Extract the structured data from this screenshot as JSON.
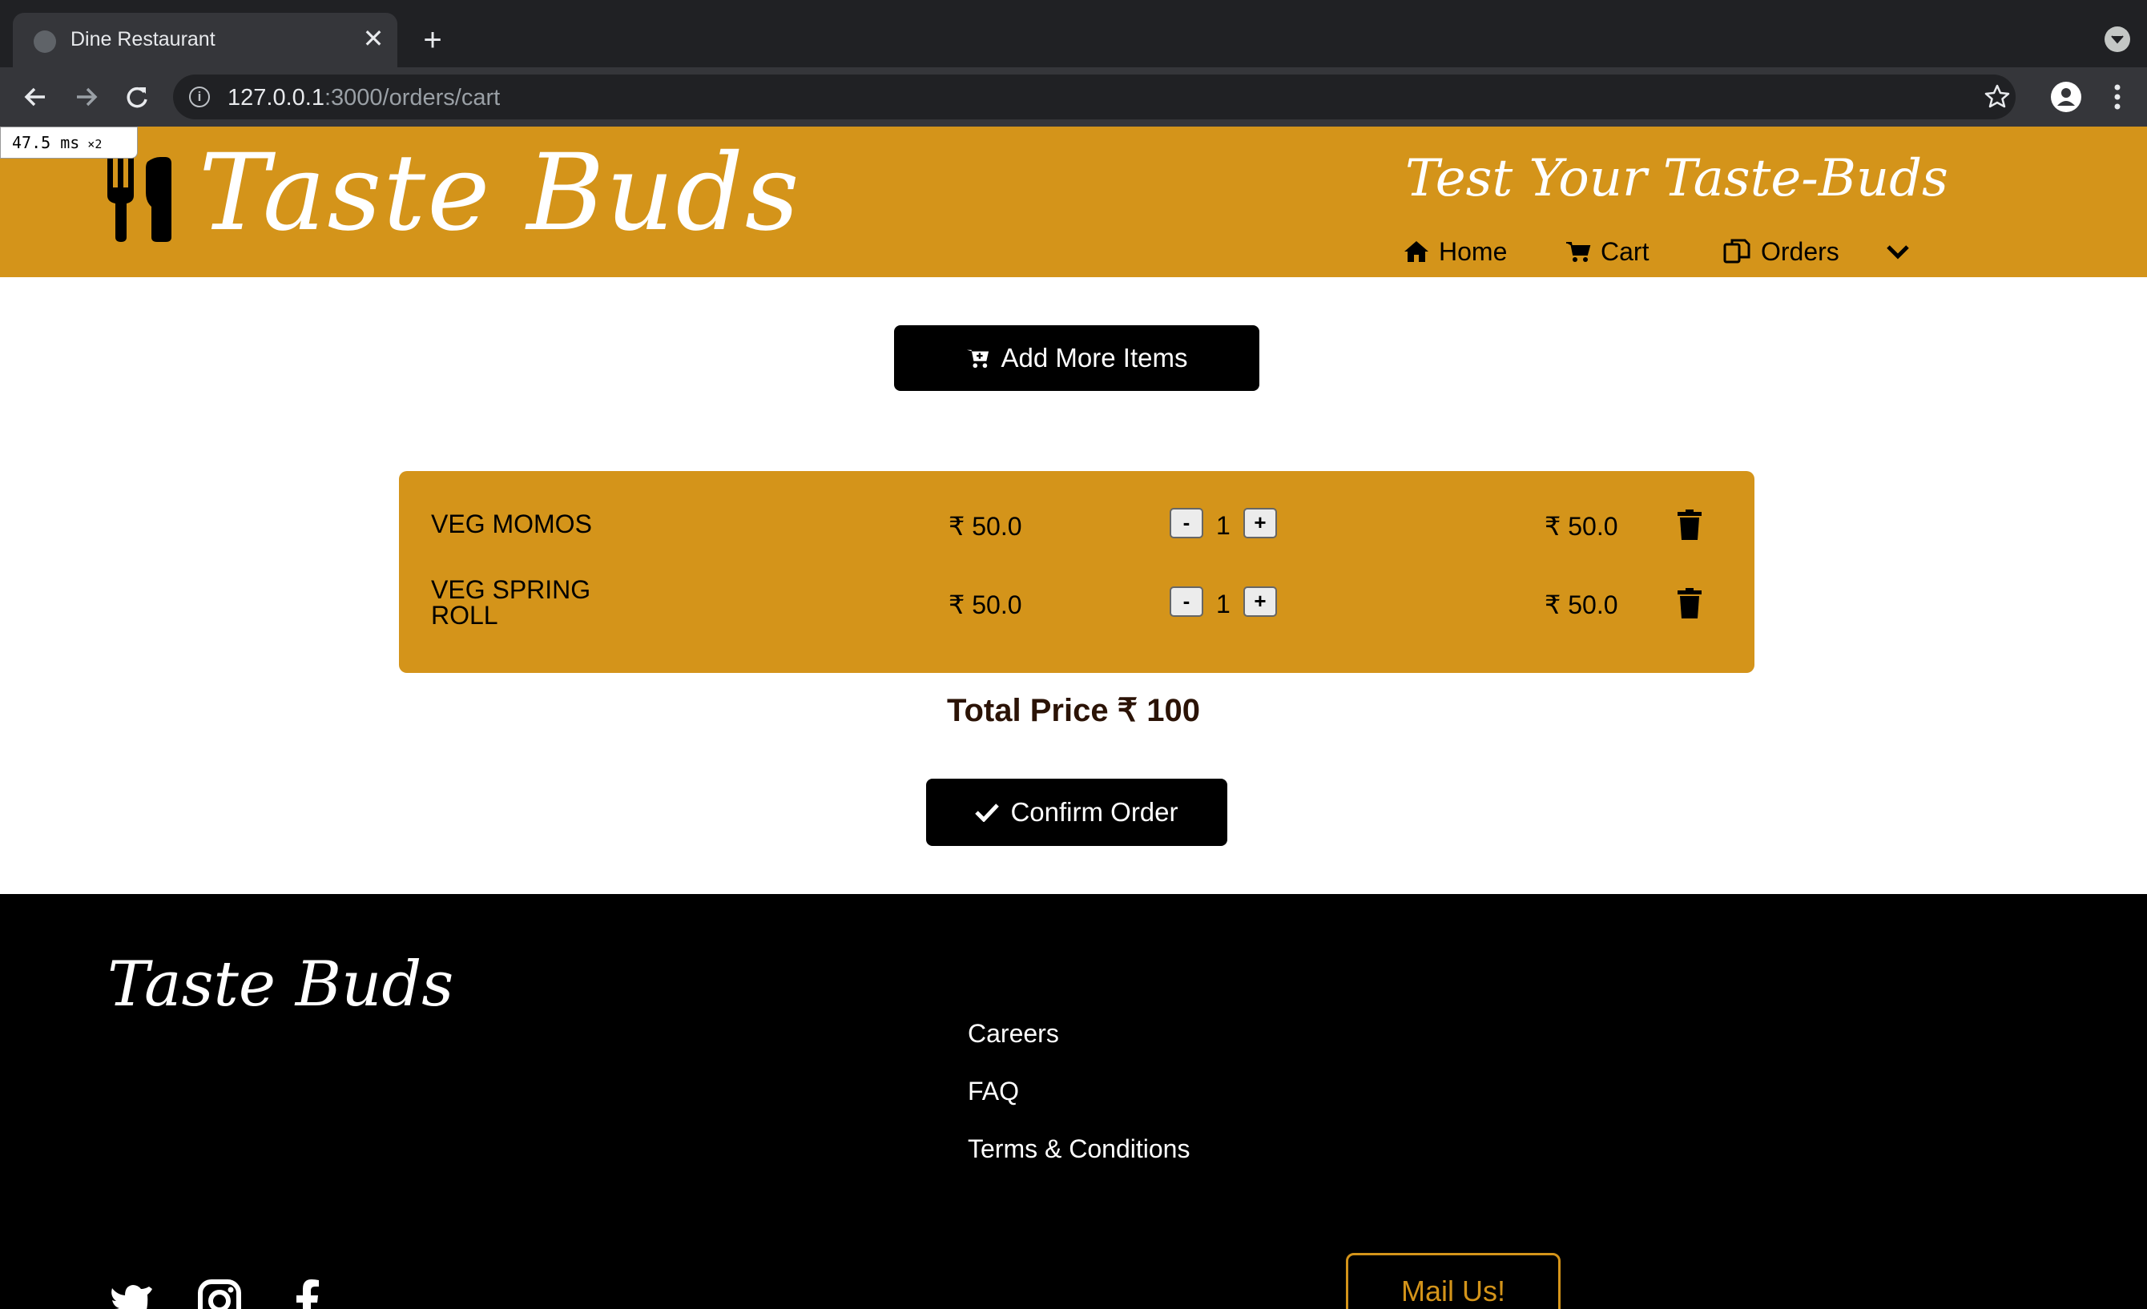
{
  "browser": {
    "tab_title": "Dine Restaurant",
    "url_host": "127.0.0.1",
    "url_path": ":3000/orders/cart",
    "perf_value": "47.5 ms",
    "perf_multiplier": "×2"
  },
  "header": {
    "logo": "Taste Buds",
    "tagline": "Test Your Taste-Buds",
    "nav": {
      "home": "Home",
      "cart": "Cart",
      "orders": "Orders"
    }
  },
  "main": {
    "add_more_label": "Add More Items",
    "currency": "₹",
    "cart_items": [
      {
        "name": "VEG MOMOS",
        "price": "₹ 50.0",
        "quantity": "1",
        "subtotal": "₹ 50.0"
      },
      {
        "name": "VEG SPRING ROLL",
        "price": "₹ 50.0",
        "quantity": "1",
        "subtotal": "₹ 50.0"
      }
    ],
    "qty_minus": "-",
    "qty_plus": "+",
    "total_label": "Total Price ₹ 100",
    "confirm_label": "Confirm Order"
  },
  "footer": {
    "logo": "Taste Buds",
    "links": [
      "Careers",
      "FAQ",
      "Terms & Conditions"
    ],
    "mail_label": "Mail Us!"
  },
  "colors": {
    "brand": "#d4941a",
    "dark": "#000000",
    "total_text": "#2b1306"
  },
  "icons": [
    "utensils-icon",
    "home-icon",
    "cart-icon",
    "orders-icon",
    "chevron-down-icon",
    "cart-plus-icon",
    "check-icon",
    "trash-icon",
    "twitter-icon",
    "instagram-icon",
    "facebook-icon"
  ]
}
